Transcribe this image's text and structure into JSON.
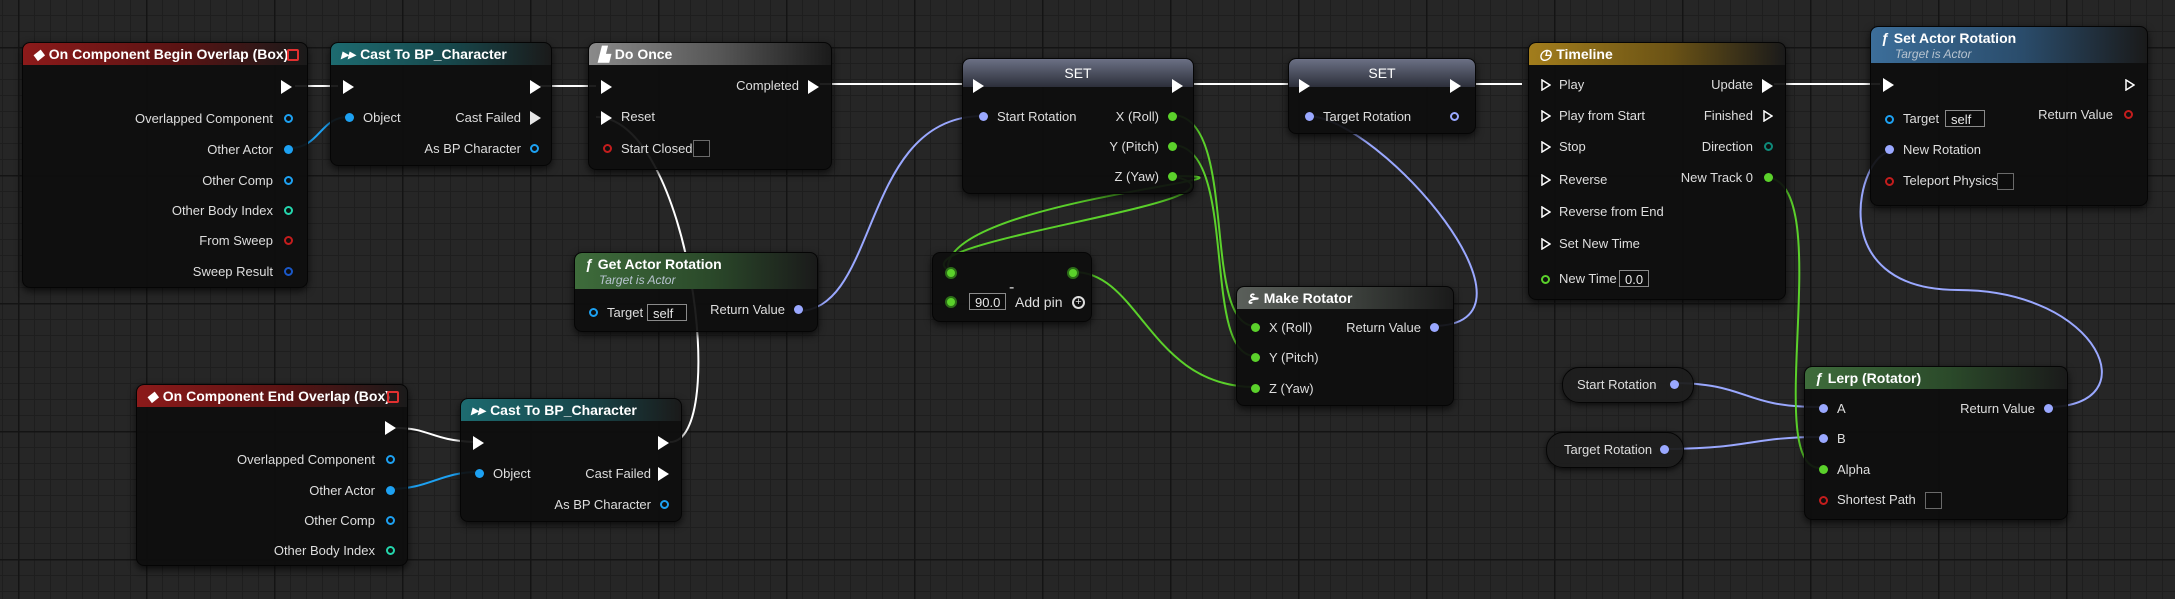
{
  "colors": {
    "exec": "#ffffff",
    "object": "#1da1f2",
    "rotator": "#9aa8ff",
    "float": "#5bd12b",
    "bool": "#c41d1d",
    "struct": "#1b6fb5",
    "hitresult": "#1a58c9",
    "int": "#24d6ad",
    "event": "#8c1a1a"
  },
  "nodes": {
    "begin_overlap": {
      "title": "On Component Begin Overlap (Box)",
      "pins": [
        "Overlapped Component",
        "Other Actor",
        "Other Comp",
        "Other Body Index",
        "From Sweep",
        "Sweep Result"
      ]
    },
    "cast1": {
      "title": "Cast To BP_Character",
      "object": "Object",
      "cast_failed": "Cast Failed",
      "as_bp": "As BP Character"
    },
    "do_once": {
      "title": "Do Once",
      "completed": "Completed",
      "reset": "Reset",
      "start_closed": "Start Closed"
    },
    "get_actor_rotation": {
      "title": "Get Actor Rotation",
      "subtitle": "Target is Actor",
      "target": "Target",
      "self": "self",
      "return_value": "Return Value"
    },
    "end_overlap": {
      "title": "On Component End Overlap (Box)",
      "pins": [
        "Overlapped Component",
        "Other Actor",
        "Other Comp",
        "Other Body Index"
      ]
    },
    "cast2": {
      "title": "Cast To BP_Character",
      "object": "Object",
      "cast_failed": "Cast Failed",
      "as_bp": "As BP Character"
    },
    "set1": {
      "title": "SET",
      "start_rotation": "Start Rotation",
      "x": "X (Roll)",
      "y": "Y (Pitch)",
      "z": "Z (Yaw)"
    },
    "subtract": {
      "op": "-",
      "value": "90.0",
      "add_pin": "Add pin"
    },
    "set2": {
      "title": "SET",
      "target_rotation": "Target Rotation"
    },
    "make_rotator": {
      "title": "Make Rotator",
      "x": "X (Roll)",
      "y": "Y (Pitch)",
      "z": "Z (Yaw)",
      "return_value": "Return Value"
    },
    "timeline": {
      "title": "Timeline",
      "inputs": [
        "Play",
        "Play from Start",
        "Stop",
        "Reverse",
        "Reverse from End",
        "Set New Time"
      ],
      "new_time": "New Time",
      "new_time_value": "0.0",
      "update": "Update",
      "finished": "Finished",
      "direction": "Direction",
      "new_track": "New Track 0"
    },
    "set_actor_rotation": {
      "title": "Set Actor Rotation",
      "subtitle": "Target is Actor",
      "target": "Target",
      "self": "self",
      "new_rotation": "New Rotation",
      "teleport": "Teleport Physics",
      "return_value": "Return Value"
    },
    "get_start_rotation": {
      "label": "Start Rotation"
    },
    "get_target_rotation": {
      "label": "Target Rotation"
    },
    "lerp": {
      "title": "Lerp (Rotator)",
      "a": "A",
      "b": "B",
      "alpha": "Alpha",
      "shortest": "Shortest Path",
      "return_value": "Return Value"
    }
  }
}
